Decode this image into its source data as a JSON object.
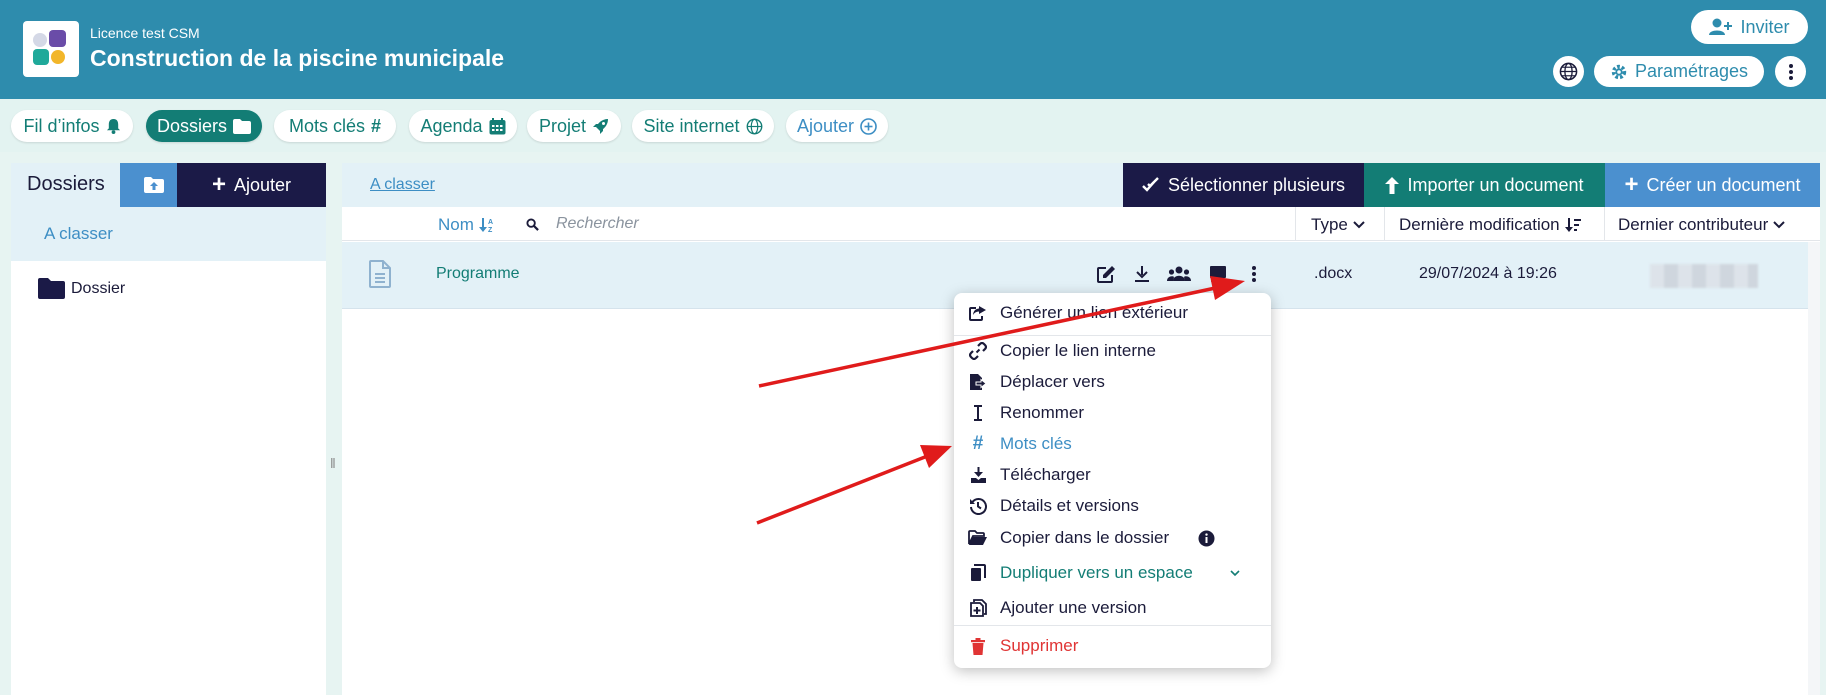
{
  "header": {
    "licence": "Licence test CSM",
    "project_title": "Construction de la piscine municipale",
    "invite_label": "Inviter",
    "settings_label": "Paramétrages",
    "accent": "#2e8cad"
  },
  "tabs": [
    {
      "label": "Fil d’infos",
      "icon": "bell-icon"
    },
    {
      "label": "Dossiers",
      "icon": "folder-icon",
      "active": true
    },
    {
      "label": "Mots clés",
      "icon": "hashtag-icon"
    },
    {
      "label": "Agenda",
      "icon": "calendar-icon"
    },
    {
      "label": "Projet",
      "icon": "rocket-icon"
    },
    {
      "label": "Site internet",
      "icon": "globe-icon"
    },
    {
      "label": "Ajouter",
      "icon": "plus-circle-icon"
    }
  ],
  "sidebar": {
    "title": "Dossiers",
    "add_label": "Ajouter",
    "selected_item": "A classer",
    "folder_item": "Dossier"
  },
  "main": {
    "breadcrumb": "A classer",
    "select_multiple_label": "Sélectionner plusieurs",
    "import_label": "Importer un document",
    "create_label": "Créer un document",
    "columns": {
      "name": "Nom",
      "search_placeholder": "Rechercher",
      "type": "Type",
      "last_modified": "Dernière modification",
      "last_contributor": "Dernier contributeur"
    },
    "rows": [
      {
        "name": "Programme",
        "type": ".docx",
        "modified": "29/07/2024 à 19:26"
      }
    ]
  },
  "context_menu": {
    "items": [
      {
        "label": "Générer un lien extérieur",
        "icon": "share-external-icon"
      },
      {
        "label": "Copier le lien interne",
        "icon": "link-icon"
      },
      {
        "label": "Déplacer vers",
        "icon": "move-file-icon"
      },
      {
        "label": "Renommer",
        "icon": "text-cursor-icon"
      },
      {
        "label": "Mots clés",
        "icon": "hashtag-icon"
      },
      {
        "label": "Télécharger",
        "icon": "download-icon"
      },
      {
        "label": "Détails et versions",
        "icon": "history-icon"
      },
      {
        "label": "Copier dans le dossier",
        "icon": "folder-open-icon"
      },
      {
        "label": "Dupliquer vers un espace",
        "icon": "copy-icon"
      },
      {
        "label": "Ajouter une version",
        "icon": "file-plus-icon"
      },
      {
        "label": "Supprimer",
        "icon": "trash-icon"
      }
    ]
  },
  "colors": {
    "teal": "#137d75",
    "blue": "#3d8ec4",
    "navy": "#1b1a47",
    "danger": "#e03434",
    "arrow": "#e01b1b"
  }
}
